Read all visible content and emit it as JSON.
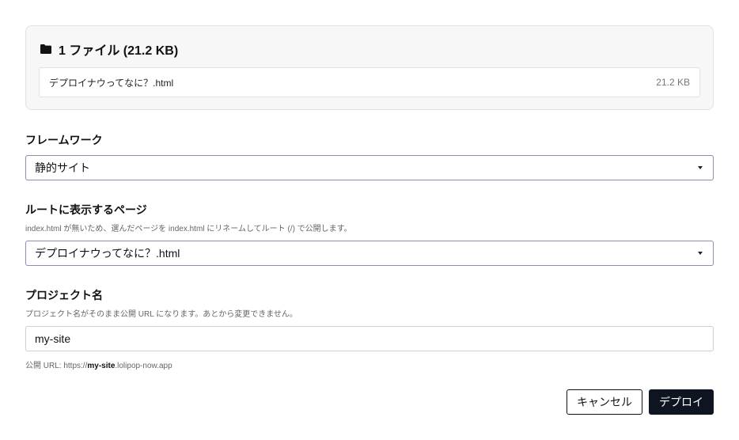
{
  "files": {
    "header": "1 ファイル (21.2 KB)",
    "icon": "folder-icon",
    "items": [
      {
        "name": "デプロイナウってなに？.html",
        "size": "21.2 KB"
      }
    ]
  },
  "framework": {
    "label": "フレームワーク",
    "selected": "静的サイト"
  },
  "root_page": {
    "label": "ルートに表示するページ",
    "help": "index.html が無いため、選んだページを index.html にリネームしてルート (/) で公開します。",
    "selected": "デプロイナウってなに？.html"
  },
  "project": {
    "label": "プロジェクト名",
    "help": "プロジェクト名がそのまま公開 URL になります。あとから変更できません。",
    "value": "my-site",
    "url_prefix": "公開 URL: https://",
    "url_name": "my-site",
    "url_suffix": ".lolipop-now.app"
  },
  "actions": {
    "cancel_label": "キャンセル",
    "deploy_label": "デプロイ"
  },
  "colors": {
    "accent": "#0e1420",
    "select_border": "#8a8eb0",
    "panel_bg": "#f7f7f7"
  }
}
